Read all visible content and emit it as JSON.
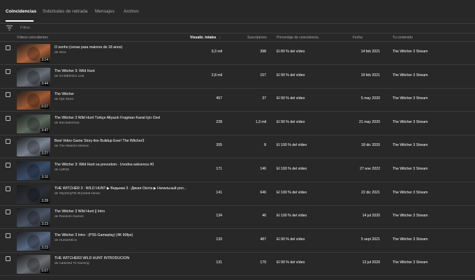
{
  "tabs": [
    {
      "label": "Coincidencias",
      "active": true
    },
    {
      "label": "Solicitudes de retirada",
      "active": false
    },
    {
      "label": "Mensajes",
      "active": false
    },
    {
      "label": "Archivo",
      "active": false
    }
  ],
  "filter": {
    "placeholder": "Filtrar"
  },
  "table": {
    "headers": {
      "video": "Vídeos coincidentes",
      "views": "Visualiz. totales",
      "subs": "Suscriptores",
      "pct": "Porcentaje de coincidencia",
      "date": "Fecha",
      "content": "Tu contenido"
    },
    "sort_indicator": "↓",
    "rows": [
      {
        "title": "O sonho (cenas para maiores de 18 anos)",
        "channel": "de ISeo",
        "duration": "3:14",
        "views": "9,3 mil",
        "subs": "398",
        "pct": "El 80 % del vídeo",
        "date": "14 feb 2021",
        "content": "The Witcher 3 Stream",
        "thumb": "#b0643c"
      },
      {
        "title": "The Witcher 3: Wild Hunt",
        "channel": "de GAMER3o1 Link",
        "duration": "3:44",
        "views": "2,8 mil",
        "subs": "157",
        "pct": "El 90 % del vídeo",
        "date": "19 feb 2021",
        "content": "The Witcher 3 Stream",
        "thumb": "#6a6f7a"
      },
      {
        "title": "The Witcher",
        "channel": "de Opt Store",
        "duration": "6:07",
        "views": "457",
        "subs": "37",
        "pct": "El 90 % del vídeo",
        "date": "5 may 2020",
        "content": "The Witcher 3 Stream",
        "thumb": "#a25a34"
      },
      {
        "title": "The Witcher 3 Wild Hunt Türkçe Altyazılı Fragman Kanal İçin Özel",
        "channel": "de thecoldermas",
        "duration": "3:47",
        "views": "228",
        "subs": "1,3 mil",
        "pct": "El 90 % del vídeo",
        "date": "21 may 2020",
        "content": "The Witcher 3 Stream",
        "thumb": "#5e6a60"
      },
      {
        "title": "Best Video Game Story-line Buildup Ever! The Witcher3",
        "channel": "de The Mastimi Maniac",
        "duration": "3:27",
        "views": "205",
        "subs": "8",
        "pct": "El 100 % del vídeo",
        "date": "18 dic 2020",
        "content": "The Witcher 3 Stream",
        "thumb": "#7b8492"
      },
      {
        "title": "The Witcher 3: Wild Hunt sa prevodom - Uvodna sekvenca #0",
        "channel": "de cafff45",
        "duration": "3:16",
        "views": "171",
        "subs": "146",
        "pct": "El 100 % del vídeo",
        "date": "27 ene 2022",
        "content": "The Witcher 3 Stream",
        "thumb": "#3a4d6a"
      },
      {
        "title": "THE WITCHER 3 : WILD HUNT ▶ Ведьмак 3 - Дикая Охота ▶ Начальный рол...",
        "channel": "de SkyZergTM Игровой канал",
        "duration": "3:28",
        "views": "141",
        "subs": "646",
        "pct": "El 100 % del vídeo",
        "date": "22 dic 2021",
        "content": "The Witcher 3 Stream",
        "thumb": "#2c2f38"
      },
      {
        "title": "The Witcher 3 Wild Hunt || Intro",
        "channel": "de Random Games",
        "duration": "3:23",
        "views": "134",
        "subs": "46",
        "pct": "El 100 % del vídeo",
        "date": "14 jul 2020",
        "content": "The Witcher 3 Stream",
        "thumb": "#4c5566"
      },
      {
        "title": "The Witcher 3 Intro : (PS5 Gameplay) (4K 60fps)",
        "channel": "de HunterMCvi",
        "duration": "3:23",
        "views": "133",
        "subs": "487",
        "pct": "El 90 % del vídeo",
        "date": "5 sept 2021",
        "content": "The Witcher 3 Stream",
        "thumb": "#5a6a84"
      },
      {
        "title": "THE WITCHER3 WILD HUNT INTRODUCION",
        "channel": "de Addicted To Gaming",
        "duration": "5:07",
        "views": "131",
        "subs": "179",
        "pct": "El 90 % del vídeo",
        "date": "13 jul 2020",
        "content": "The Witcher 3 Stream",
        "thumb": "#6b6f74"
      }
    ]
  }
}
